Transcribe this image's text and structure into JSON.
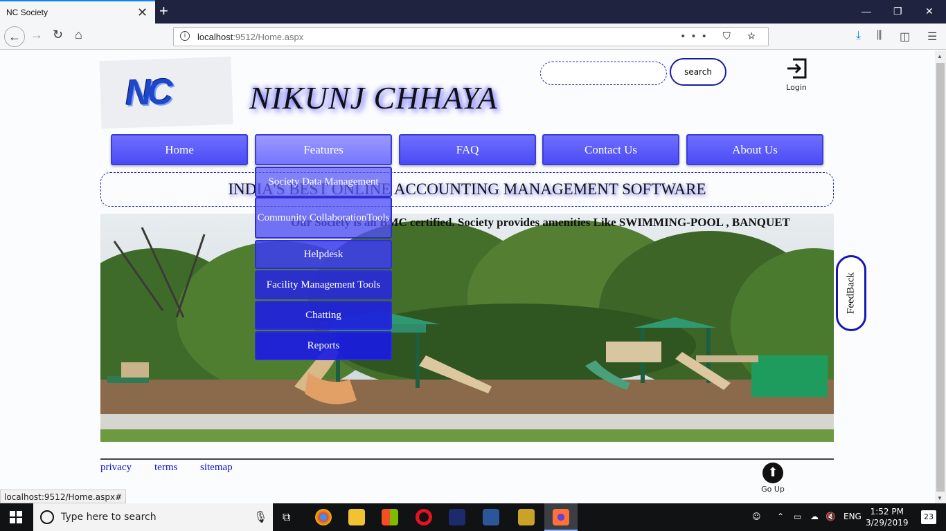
{
  "browser": {
    "tab_title": "NC Society",
    "url_host": "localhost",
    "url_rest": ":9512/Home.aspx",
    "status_url": "localhost:9512/Home.aspx#"
  },
  "header": {
    "logo_text": "NC",
    "brand_title": "NIKUNJ CHHAYA",
    "search_button": "search",
    "login_label": "Login"
  },
  "menu": {
    "items": [
      {
        "label": "Home"
      },
      {
        "label": "Features"
      },
      {
        "label": "FAQ"
      },
      {
        "label": "Contact Us"
      },
      {
        "label": "About Us"
      }
    ],
    "features_dropdown": [
      {
        "label": "Society Data Management"
      },
      {
        "label": "Community CollaborationTools"
      },
      {
        "label": "Helpdesk"
      },
      {
        "label": "Facility Management Tools"
      },
      {
        "label": "Chatting"
      },
      {
        "label": "Reports"
      }
    ]
  },
  "main": {
    "tagline": "INDIA'S BEST ONLINE ACCOUNTING MANAGEMENT SOFTWARE",
    "marquee_text": "Our Society is an BMC certified. Society provides amenities Like SWIMMING-POOL , BANQUET",
    "feedback_label": "FeedBack"
  },
  "footer": {
    "links": [
      {
        "label": "privacy"
      },
      {
        "label": "terms"
      },
      {
        "label": "sitemap"
      }
    ],
    "goup_label": "Go Up"
  },
  "taskbar": {
    "search_placeholder": "Type here to search",
    "language": "ENG",
    "time": "1:52 PM",
    "date": "3/29/2019",
    "notification_count": "23"
  },
  "colors": {
    "menu_blue": "#4b4bf5",
    "dropdown_blue": "#3737f0",
    "border_blue": "#1616b4",
    "tab_accent": "#0a84ff"
  }
}
